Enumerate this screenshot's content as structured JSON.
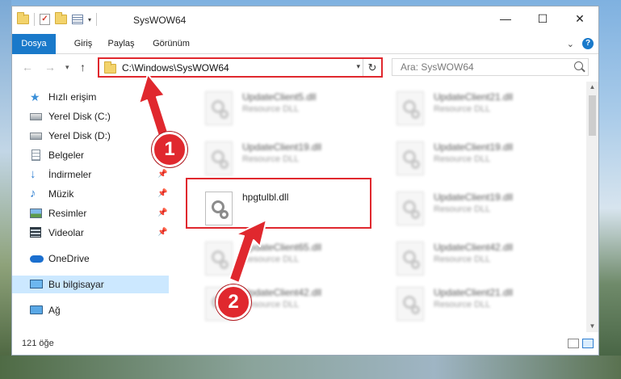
{
  "window": {
    "title": "SysWOW64",
    "controls": {
      "minimize": "—",
      "maximize": "☐",
      "close": "✕"
    }
  },
  "ribbon": {
    "tabs": [
      "Dosya",
      "Giriş",
      "Paylaş",
      "Görünüm"
    ],
    "help": "?"
  },
  "address": {
    "path": "C:\\Windows\\SysWOW64",
    "search_placeholder": "Ara: SysWOW64"
  },
  "sidebar": {
    "items": [
      {
        "label": "Hızlı erişim",
        "icon": "star-icon"
      },
      {
        "label": "Yerel Disk (C:)",
        "icon": "drive-icon"
      },
      {
        "label": "Yerel Disk (D:)",
        "icon": "drive-icon"
      },
      {
        "label": "Belgeler",
        "icon": "documents-icon"
      },
      {
        "label": "İndirmeler",
        "icon": "download-icon",
        "pinned": true
      },
      {
        "label": "Müzik",
        "icon": "music-icon",
        "pinned": true
      },
      {
        "label": "Resimler",
        "icon": "pictures-icon",
        "pinned": true
      },
      {
        "label": "Videolar",
        "icon": "videos-icon",
        "pinned": true
      },
      {
        "label": "OneDrive",
        "icon": "cloud-icon"
      },
      {
        "label": "Bu bilgisayar",
        "icon": "computer-icon",
        "selected": true
      },
      {
        "label": "Ağ",
        "icon": "network-icon"
      }
    ]
  },
  "files": {
    "left": [
      {
        "name": "UpdateClient5.dll",
        "type": "Resource DLL"
      },
      {
        "name": "UpdateClient19.dll",
        "type": "Resource DLL"
      },
      {
        "name": "hpgtulbl.dll",
        "type": ""
      },
      {
        "name": "UpdateClient65.dll",
        "type": "Resource DLL"
      },
      {
        "name": "UpdateClient42.dll",
        "type": "Resource DLL"
      }
    ],
    "right": [
      {
        "name": "UpdateClient21.dll",
        "type": "Resource DLL"
      },
      {
        "name": "UpdateClient19.dll",
        "type": "Resource DLL"
      },
      {
        "name": "UpdateClient19.dll",
        "type": "Resource DLL"
      },
      {
        "name": "UpdateClient42.dll",
        "type": "Resource DLL"
      },
      {
        "name": "UpdateClient21.dll",
        "type": "Resource DLL"
      }
    ]
  },
  "status": {
    "count": "121 öğe"
  },
  "annotations": {
    "step1": "1",
    "step2": "2",
    "accent": "#e0282e"
  }
}
